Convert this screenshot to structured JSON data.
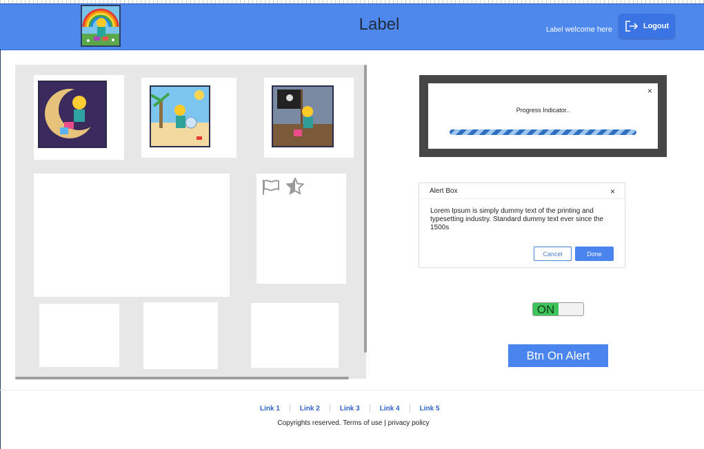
{
  "header": {
    "title": "Label",
    "welcome_label": "Label",
    "welcome_text": "welcome here",
    "logout_label": "Logout",
    "background_color": "#4f88ec"
  },
  "icons": {
    "logo": "pixel-art-sun-creature-logo",
    "logout": "logout-icon",
    "flag": "flag-icon",
    "star": "half-star-icon"
  },
  "gallery": {
    "images": [
      {
        "name": "crescent-moon-creature"
      },
      {
        "name": "beach-palm-creature"
      },
      {
        "name": "pirate-ship-creature"
      }
    ]
  },
  "progress_dialog": {
    "text": "Progress Indicator..",
    "close": "×"
  },
  "alert": {
    "title": "Alert Box",
    "close": "×",
    "body": "Lorem Ipsum is simply dummy text of the printing and typesetting industry. Standard dummy text ever since the 1500s",
    "cancel_label": "Cancel",
    "done_label": "Done"
  },
  "toggle": {
    "state_label": "ON",
    "on_color": "#3ec45a"
  },
  "action_button": {
    "label": "Btn On Alert"
  },
  "footer": {
    "links": [
      "Link 1",
      "Link 2",
      "Link 3",
      "Link 4",
      "Link 5"
    ],
    "copyright_text": "Copyrights reserved. Terms of use",
    "separator": "|",
    "privacy_text": "privacy policy"
  }
}
